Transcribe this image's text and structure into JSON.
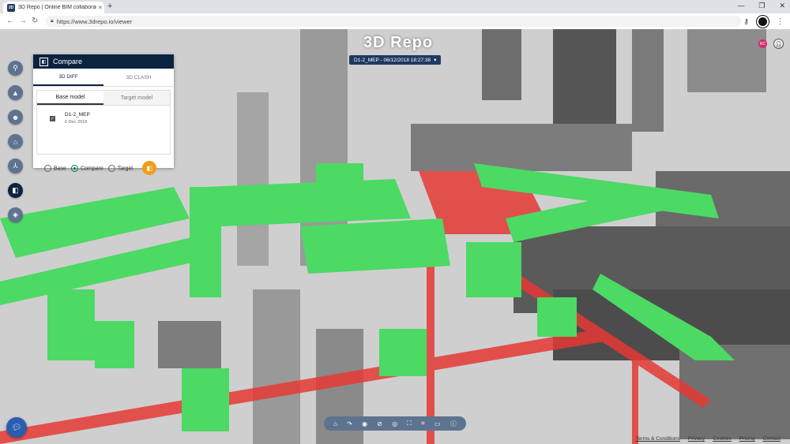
{
  "browser": {
    "tab_title": "3D Repo | Online BIM collaborati",
    "tab_close": "×",
    "new_tab": "+",
    "favicon_text": "3D",
    "url": "https://www.3drepo.io/viewer",
    "window_controls": [
      "—",
      "❐",
      "✕"
    ]
  },
  "viewer": {
    "logo": "3D Repo",
    "revision": "D1-2_MEP - 06/12/2018 18:27:38",
    "user_badge": "RC"
  },
  "left_toolbar": [
    "pin",
    "warning",
    "face",
    "camera",
    "tree",
    "compare",
    "layers"
  ],
  "compare_panel": {
    "title": "Compare",
    "tabs": [
      "3D DIFF",
      "3D CLASH"
    ],
    "model_tabs": [
      "Base model",
      "Target model"
    ],
    "model": {
      "name": "D1-2_MEP",
      "date": "6 Dec 2018"
    },
    "radios": [
      "Base",
      "Compare",
      "Target"
    ],
    "selected_radio": "Compare"
  },
  "bottom_toolbar": [
    "home-icon",
    "turntable-icon",
    "show-all-icon",
    "hide-icon",
    "isolate-icon",
    "focus-icon",
    "clip-icon",
    "measure-icon",
    "info-icon"
  ],
  "footer_links": [
    "Terms & Conditions",
    "Privacy",
    "Cookies",
    "Pricing",
    "Contact"
  ],
  "colors": {
    "accent": "#0c2340",
    "diff_green": "#4cd964",
    "diff_red": "#e53935",
    "compare_fab": "#f19d1a"
  }
}
